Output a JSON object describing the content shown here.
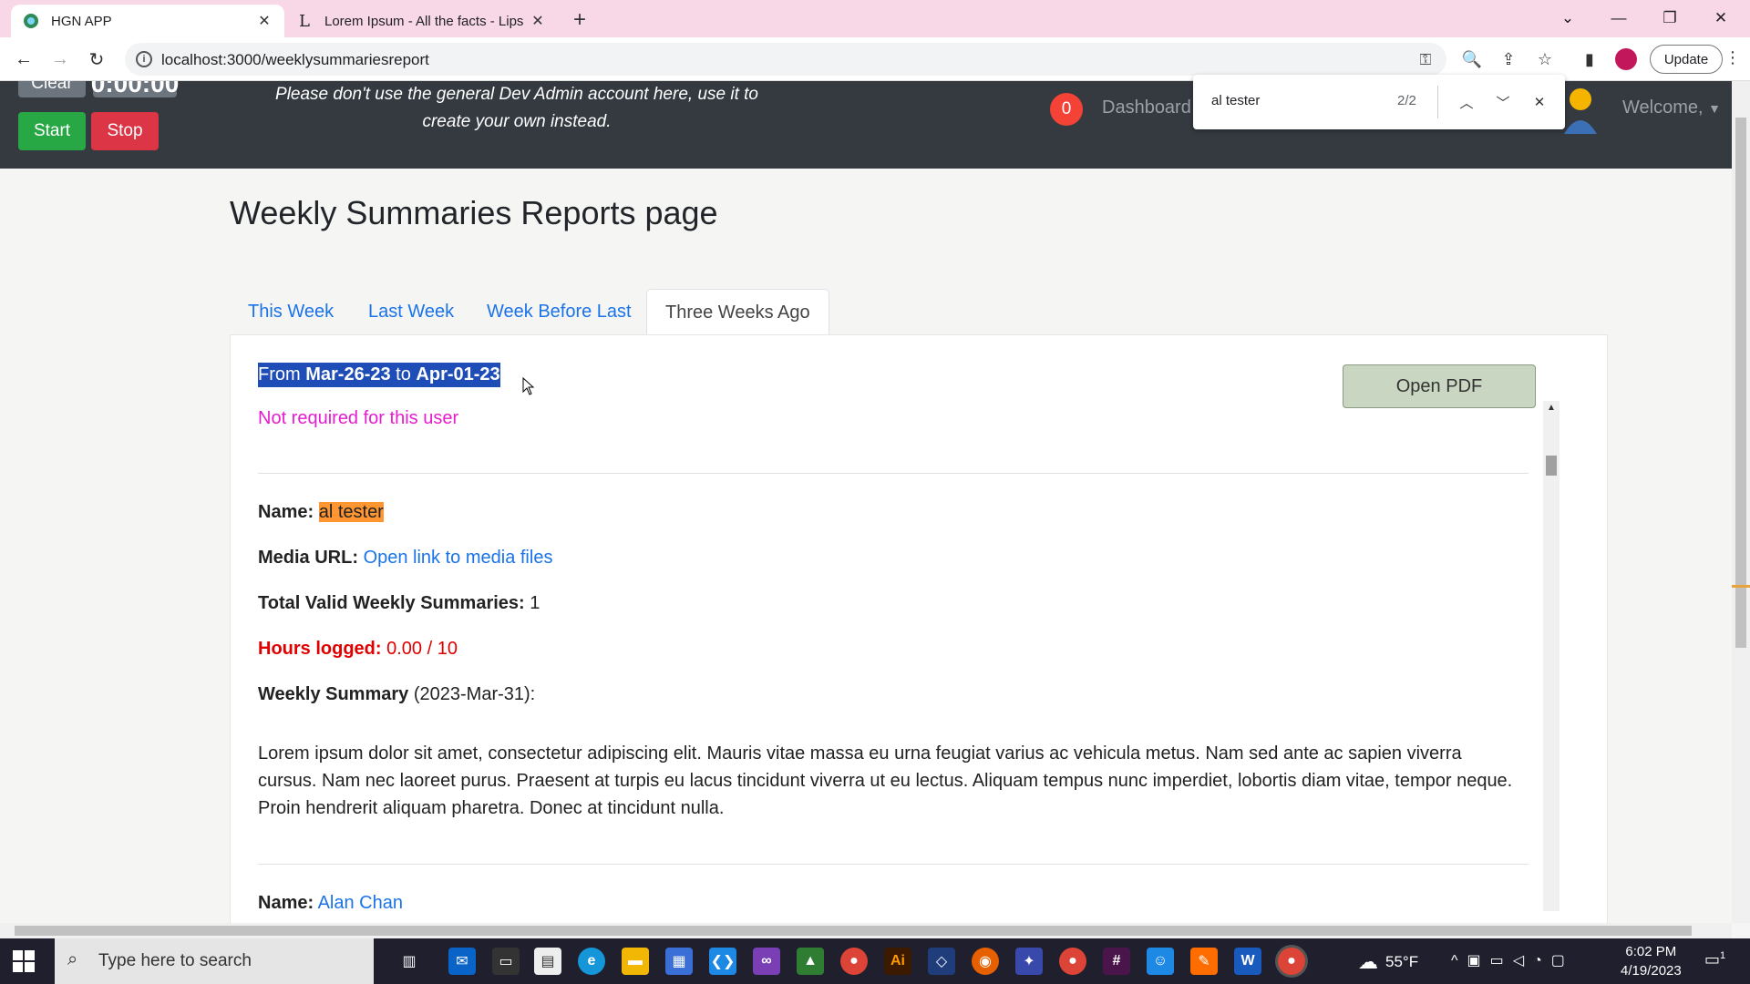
{
  "browser": {
    "tabs": [
      {
        "title": "HGN APP",
        "active": true
      },
      {
        "title": "Lorem Ipsum - All the facts - Lips",
        "active": false
      }
    ],
    "url": "localhost:3000/weeklysummariesreport",
    "update_label": "Update"
  },
  "find_bar": {
    "query": "al tester",
    "count": "2/2"
  },
  "header": {
    "clear_label": "Clear",
    "timer": "0:00:00",
    "start_label": "Start",
    "stop_label": "Stop",
    "notice_line1": "Please don't use the general Dev Admin account here, use it to",
    "notice_line2": "create your own instead.",
    "notification_count": "0",
    "dashboard_label": "Dashboard",
    "welcome_label": "Welcome,"
  },
  "page": {
    "title": "Weekly Summaries Reports page",
    "tabs": [
      "This Week",
      "Last Week",
      "Week Before Last",
      "Three Weeks Ago"
    ],
    "active_tab": "Three Weeks Ago",
    "range_from_prefix": "From ",
    "range_from": "Mar-26-23",
    "range_to_prefix": " to ",
    "range_to": "Apr-01-23",
    "open_pdf_label": "Open PDF",
    "not_required": "Not required for this user"
  },
  "users": [
    {
      "name_label": "Name:",
      "name": "al tester",
      "media_label": "Media URL:",
      "media_link": "Open link to media files",
      "valid_label": "Total Valid Weekly Summaries:",
      "valid_count": "1",
      "hours_label": "Hours logged:",
      "hours_value": "0.00 / 10",
      "summary_label": "Weekly Summary",
      "summary_date": "(2023-Mar-31):",
      "summary_text": "Lorem ipsum dolor sit amet, consectetur adipiscing elit. Mauris vitae massa eu urna feugiat varius ac vehicula metus. Nam sed ante ac sapien viverra cursus. Nam nec laoreet purus. Praesent at turpis eu lacus tincidunt viverra ut eu lectus. Aliquam tempus nunc imperdiet, lobortis diam vitae, tempor neque. Proin hendrerit aliquam pharetra. Donec at tincidunt nulla."
    },
    {
      "name_label": "Name:",
      "name": "Alan Chan"
    }
  ],
  "taskbar": {
    "search_placeholder": "Type here to search",
    "temperature": "55°F",
    "time": "6:02 PM",
    "date": "4/19/2023",
    "notification_count": "1"
  },
  "colors": {
    "header_bg": "#343a40",
    "start_green": "#28a745",
    "stop_red": "#dc3545",
    "link_blue": "#1a73e8",
    "magenta_text": "#e61dcf",
    "highlight": "#ff9632",
    "selection": "#1e4db7"
  }
}
